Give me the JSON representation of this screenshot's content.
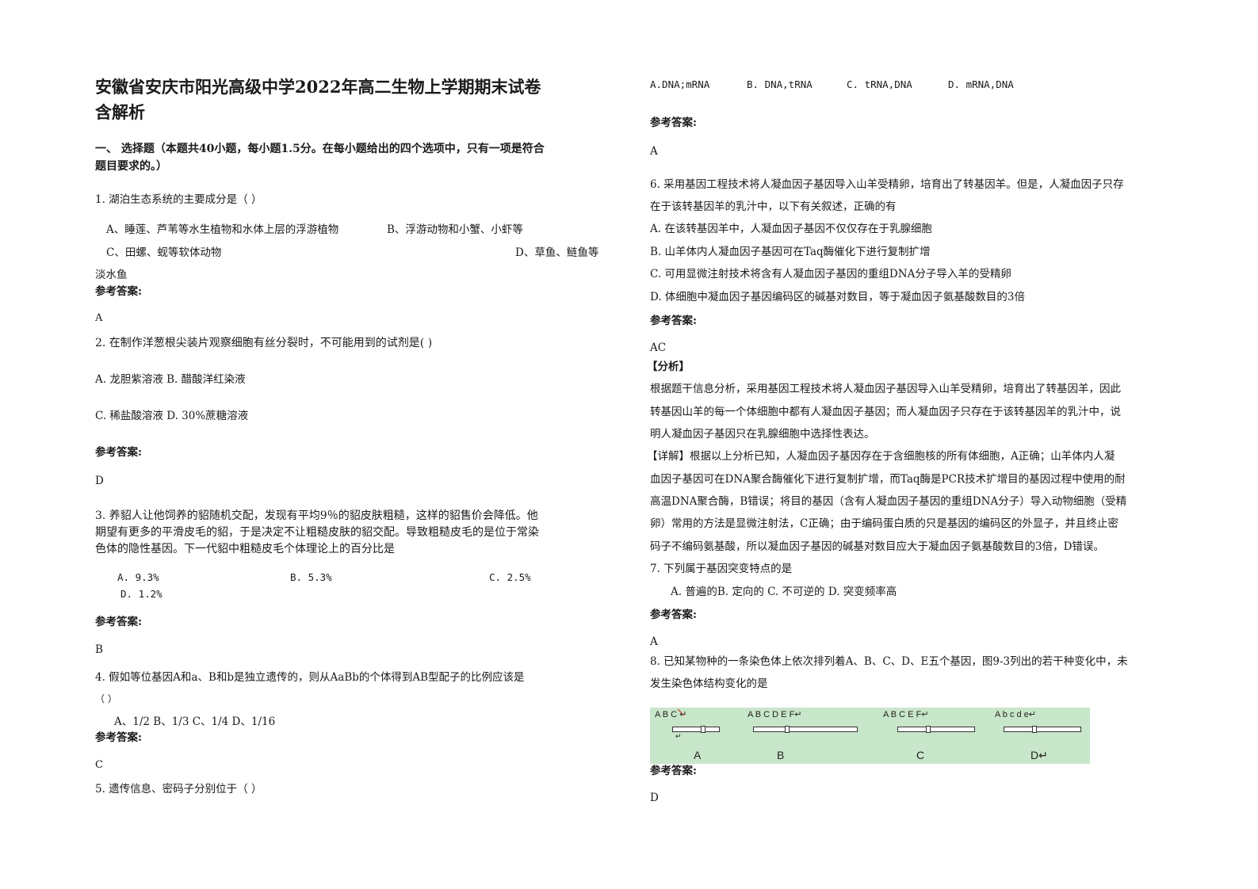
{
  "title": [
    "安徽省安庆市阳光高级中学2022年高二生物上学期期末试卷",
    "含解析"
  ],
  "section": [
    "一、 选择题（本题共40小题，每小题1.5分。在每小题给出的四个选项中，只有一项是符合",
    "题目要求的。）"
  ],
  "answer_label": "参考答案:",
  "q1": {
    "stem": "1. 湖泊生态系统的主要成分是（                    ）",
    "a": "A、睡莲、芦苇等水生植物和水体上层的浮游植物",
    "b": "B、浮游动物和小蟹、小虾等",
    "c": "C、田螺、蚬等软体动物",
    "d": "D、草鱼、鲢鱼等",
    "d2": "淡水鱼",
    "answer": "A"
  },
  "q2": {
    "stem": "2. 在制作洋葱根尖装片观察细胞有丝分裂时，不可能用到的试剂是(          )",
    "ab": "A. 龙胆紫溶液    B. 醋酸洋红染液",
    "cd": "C. 稀盐酸溶液    D. 30%蔗糖溶液",
    "answer": "D"
  },
  "q3": {
    "stem": [
      "3. 养貂人让他饲养的貂随机交配，发现有平均9％的貂皮肤粗糙，这样的貂售价会降低。他",
      "期望有更多的平滑皮毛的貂，于是决定不让粗糙皮肤的貂交配。导致粗糙皮毛的是位于常染",
      "色体的隐性基因。下一代貂中粗糙皮毛个体理论上的百分比是"
    ],
    "a": "A. 9.3%",
    "b": "B. 5.3%",
    "c": "C. 2.5%",
    "d": "D. 1.2%",
    "answer": "B"
  },
  "q4": {
    "stem": "4. 假如等位基因A和a、B和b是独立遗传的，则从AaBb的个体得到AB型配子的比例应该是",
    "paren": "（          ）",
    "opts": "A、1/2          B、1/3          C、1/4          D、1/16",
    "answer": "C"
  },
  "q5": {
    "stem": "5. 遗传信息、密码子分别位于（                  ）",
    "a": "A.DNA;mRNA",
    "b": "B. DNA,tRNA",
    "c": "C. tRNA,DNA",
    "d": "D. mRNA,DNA",
    "answer": "A"
  },
  "q6": {
    "stem": [
      "6. 采用基因工程技术将人凝血因子基因导入山羊受精卵，培育出了转基因羊。但是，人凝血因子只存",
      "在于该转基因羊的乳汁中，以下有关叙述，正确的有"
    ],
    "a": "A. 在该转基因羊中，人凝血因子基因不仅仅存在于乳腺细胞",
    "b": "B. 山羊体内人凝血因子基因可在Taq酶催化下进行复制扩增",
    "c": "C. 可用显微注射技术将含有人凝血因子基因的重组DNA分子导入羊的受精卵",
    "d": "D. 体细胞中凝血因子基因编码区的碱基对数目，等于凝血因子氨基酸数目的3倍",
    "answer": "AC",
    "analysis_label": "【分析】",
    "analysis": [
      "根据题干信息分析，采用基因工程技术将人凝血因子基因导入山羊受精卵，培育出了转基因羊，因此",
      "转基因山羊的每一个体细胞中都有人凝血因子基因；而人凝血因子只存在于该转基因羊的乳汁中，说",
      "明人凝血因子基因只在乳腺细胞中选择性表达。"
    ],
    "detail": [
      "【详解】根据以上分析已知，人凝血因子基因存在于含细胞核的所有体细胞，A正确；山羊体内人凝",
      "血因子基因可在DNA聚合酶催化下进行复制扩增，而Taq酶是PCR技术扩增目的基因过程中使用的耐",
      "高温DNA聚合酶，B错误；将目的基因（含有人凝血因子基因的重组DNA分子）导入动物细胞（受精",
      "卵）常用的方法是显微注射法，C正确；由于编码蛋白质的只是基因的编码区的外显子，并且终止密",
      "码子不编码氨基酸，所以凝血因子基因的碱基对数目应大于凝血因子氨基酸数目的3倍，D错误。"
    ]
  },
  "q7": {
    "stem": "7. 下列属于基因突变特点的是",
    "opts": "A. 普遍的B. 定向的      C. 不可逆的   D. 突变频率高",
    "answer": "A"
  },
  "q8": {
    "stem": [
      "8. 已知某物种的一条染色体上依次排列着A、B、C、D、E五个基因，图9-3列出的若干种变化中，未",
      "发生染色体结构变化的是"
    ],
    "figure": {
      "a_genes": "A   B   C ↵",
      "b_genes": "A   B   C   D   E   F↵",
      "c_genes": "A   B   C   E   F↵",
      "d_genes": "A  b    c  d    e↵",
      "return_mark": "↵",
      "labels": [
        "A",
        "B",
        "C",
        "D↵"
      ]
    },
    "answer": "D"
  }
}
